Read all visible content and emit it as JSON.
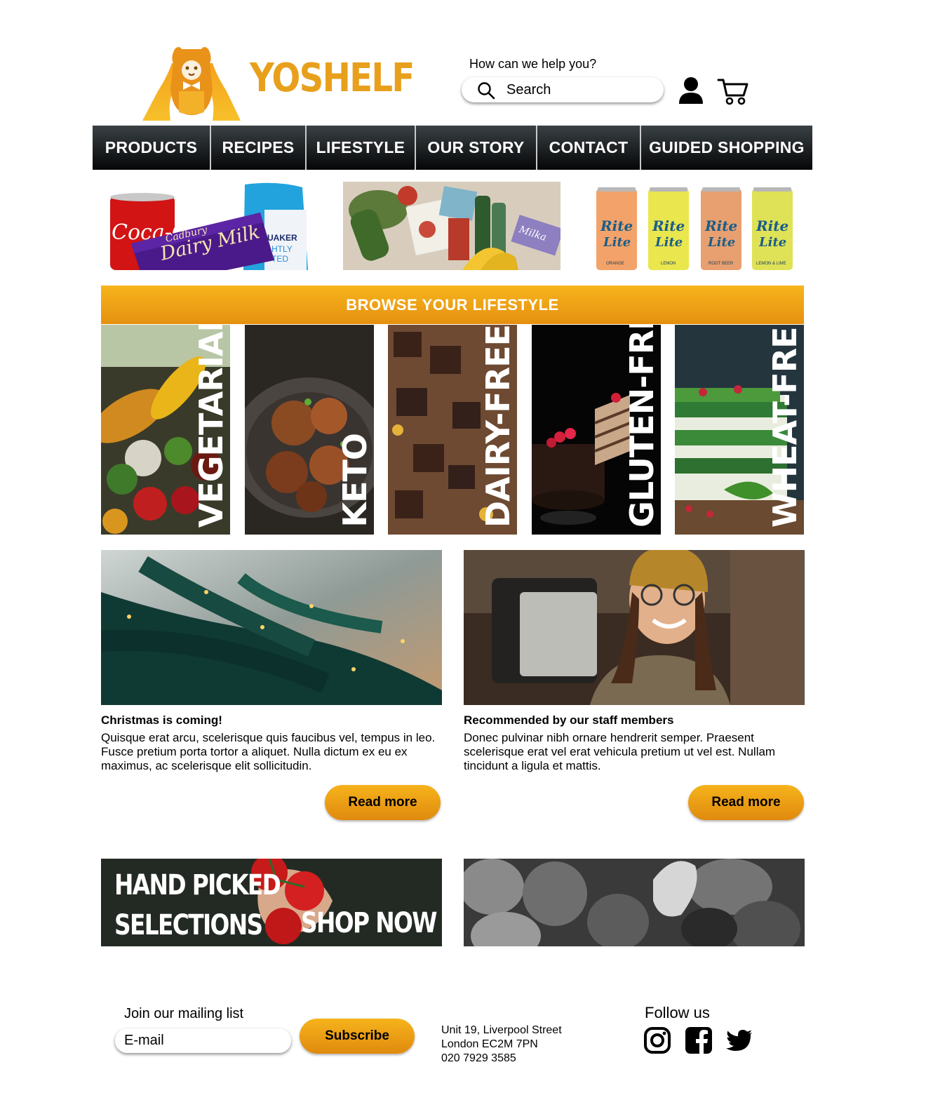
{
  "brand": {
    "name": "YOSHELF",
    "color": "#e8a01c"
  },
  "header": {
    "help_text": "How can we help you?",
    "search_placeholder": "Search",
    "icons": [
      "search-icon",
      "user-icon",
      "cart-icon"
    ]
  },
  "nav": {
    "items": [
      {
        "label": "PRODUCTS"
      },
      {
        "label": "RECIPES"
      },
      {
        "label": "LIFESTYLE"
      },
      {
        "label": "OUR STORY"
      },
      {
        "label": "CONTACT"
      },
      {
        "label": "GUIDED SHOPPING"
      }
    ]
  },
  "promos": {
    "drinks": {
      "cans": [
        "Rite 'n Lite",
        "Rite 'n Lite",
        "Rite 'n Lite",
        "Rite 'n Lite"
      ],
      "flavours": [
        "ORANGE",
        "LEMON",
        "ROOT BEER",
        "LEMON & LIME"
      ]
    },
    "snacks": {
      "brands": [
        "Coca-Cola",
        "Cadbury",
        "Dairy Milk",
        "QUAKER",
        "LIGHTLY SALTED"
      ]
    }
  },
  "lifestyle": {
    "heading": "BROWSE YOUR LIFESTYLE",
    "tiles": [
      {
        "label": "VEGETARIAN"
      },
      {
        "label": "KETO"
      },
      {
        "label": "DAIRY-FREE"
      },
      {
        "label": "GLUTEN-FREE"
      },
      {
        "label": "WHEAT-FREE"
      }
    ]
  },
  "articles": [
    {
      "title": "Christmas is coming!",
      "body": "Quisque erat arcu, scelerisque quis faucibus vel, tempus in leo. Fusce pretium porta tortor a aliquet. Nulla dictum ex eu ex maximus, ac scelerisque elit sollicitudin.",
      "button": "Read more"
    },
    {
      "title": "Recommended by our staff members",
      "body": "Donec pulvinar nibh ornare hendrerit semper. Praesent scelerisque erat vel erat vehicula pretium ut vel est. Nullam tincidunt a ligula et mattis.",
      "button": "Read more"
    }
  ],
  "banners": {
    "hand_picked_line1": "HAND PICKED",
    "hand_picked_line2": "SELECTIONS",
    "shop_now": "SHOP NOW"
  },
  "footer": {
    "mailing_label": "Join our mailing list",
    "email_placeholder": "E-mail",
    "subscribe_label": "Subscribe",
    "address_line1": "Unit 19, Liverpool Street",
    "address_line2": "London EC2M 7PN",
    "phone": "020 7929 3585",
    "follow_label": "Follow us",
    "social_icons": [
      "instagram-icon",
      "facebook-icon",
      "twitter-icon"
    ]
  },
  "colors": {
    "accent": "#f0a316",
    "nav_bg": "#1c2022"
  }
}
